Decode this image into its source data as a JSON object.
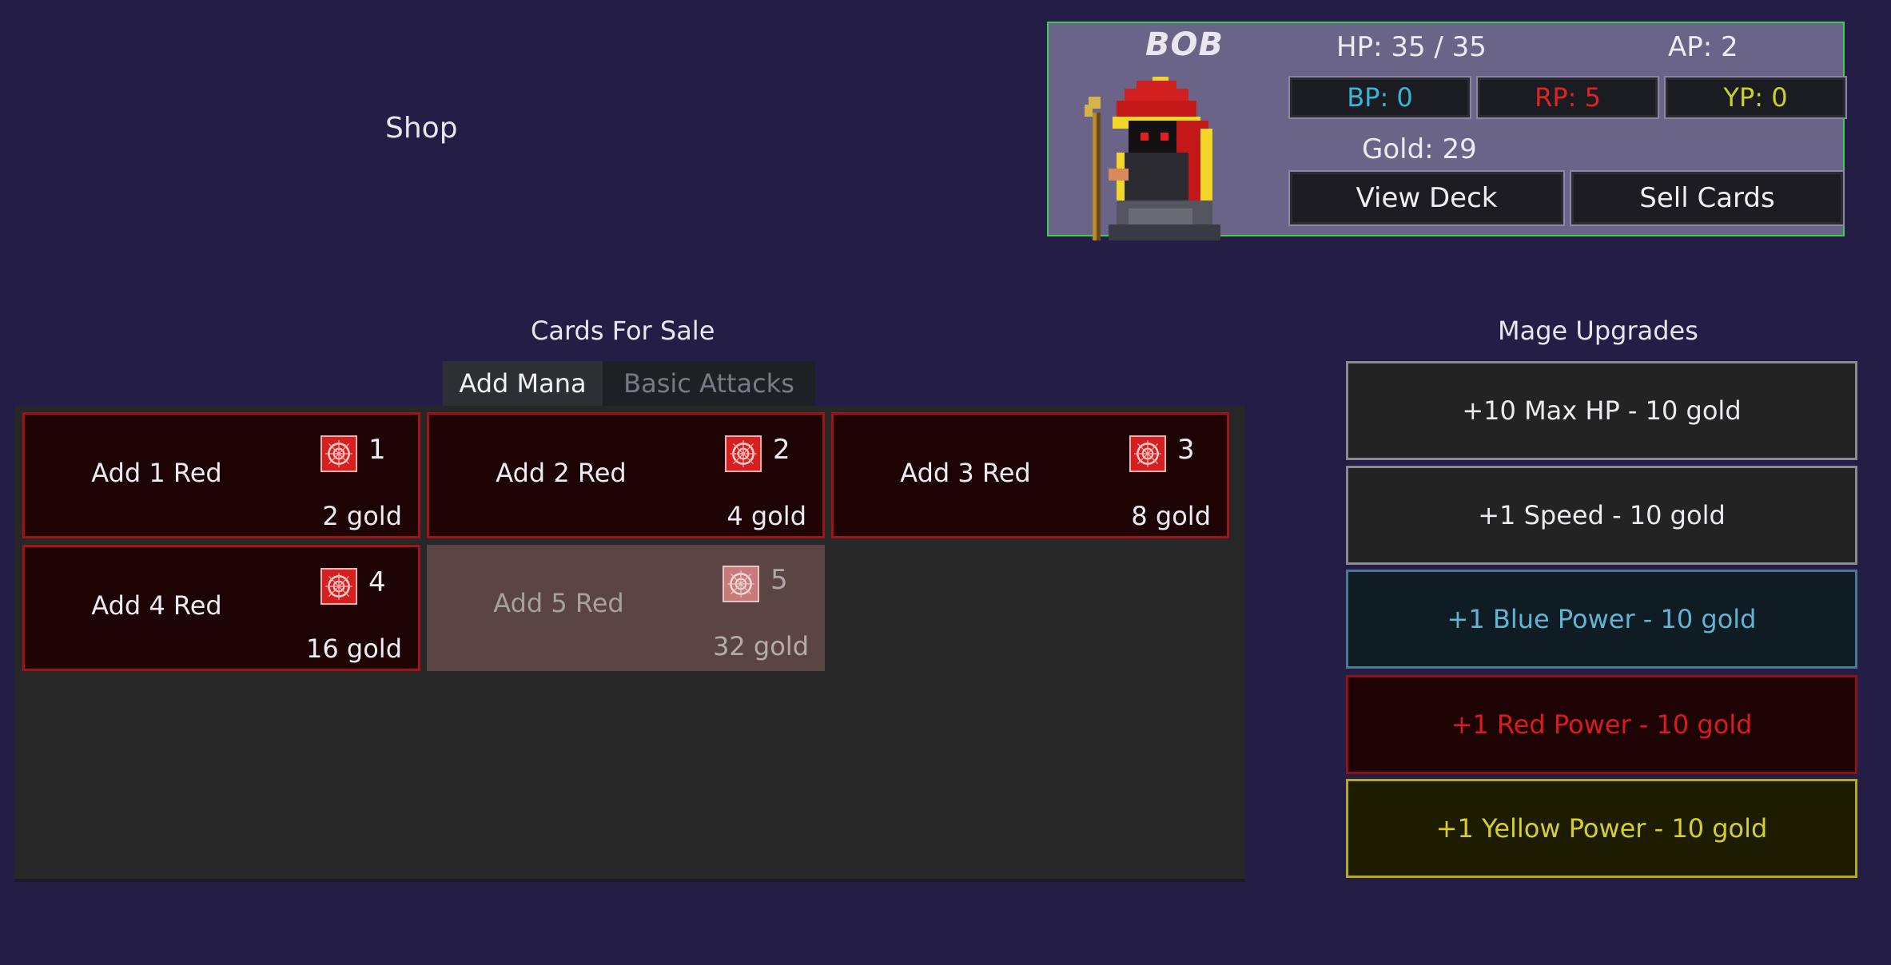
{
  "shop": {
    "title": "Shop"
  },
  "player": {
    "name": "BOB",
    "hp": "HP: 35 / 35",
    "ap": "AP: 2",
    "bp": "BP: 0",
    "rp": "RP: 5",
    "yp": "YP: 0",
    "gold": "Gold: 29",
    "view_deck_label": "View Deck",
    "sell_cards_label": "Sell Cards"
  },
  "cards_for_sale": {
    "title": "Cards For Sale",
    "tabs": [
      {
        "label": "Add Mana",
        "active": true
      },
      {
        "label": "Basic Attacks",
        "active": false
      }
    ],
    "cards": [
      {
        "name": "Add 1 Red",
        "count": "1",
        "price": "2 gold",
        "affordable": true
      },
      {
        "name": "Add 2 Red",
        "count": "2",
        "price": "4 gold",
        "affordable": true
      },
      {
        "name": "Add 3 Red",
        "count": "3",
        "price": "8 gold",
        "affordable": true
      },
      {
        "name": "Add 4 Red",
        "count": "4",
        "price": "16 gold",
        "affordable": true
      },
      {
        "name": "Add 5 Red",
        "count": "5",
        "price": "32 gold",
        "affordable": false
      }
    ]
  },
  "mage_upgrades": {
    "title": "Mage Upgrades",
    "items": [
      {
        "label": "+10 Max HP - 10 gold"
      },
      {
        "label": "+1 Speed - 10 gold"
      },
      {
        "label": "+1 Blue Power - 10 gold"
      },
      {
        "label": "+1 Red Power - 10 gold"
      },
      {
        "label": "+1 Yellow Power - 10 gold"
      }
    ]
  },
  "colors": {
    "background": "#241e47",
    "panel_border": "#3ecf4a",
    "blue": "#36b6d8",
    "red": "#e02424",
    "yellow": "#c9d227"
  },
  "icons": {
    "mana": "red-mana-icon",
    "avatar": "red-mage-avatar"
  }
}
